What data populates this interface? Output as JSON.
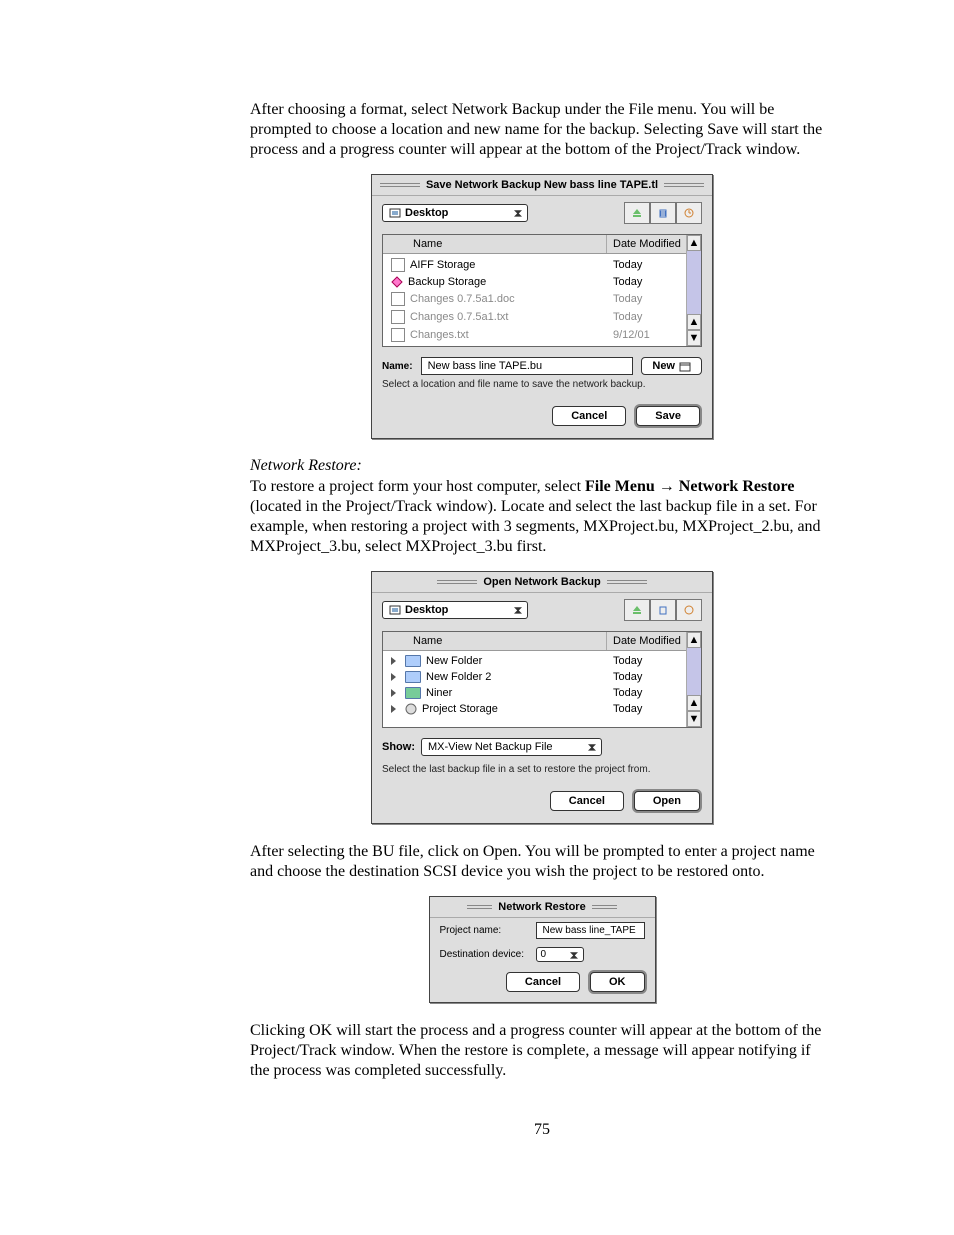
{
  "page_number": "75",
  "para1": "After choosing a format, select Network Backup under the File menu. You will be prompted to choose a location and new name for the backup.  Selecting Save will start the process and a progress counter will appear at the bottom of the Project/Track window.",
  "dialog_save": {
    "title": "Save Network Backup New bass line TAPE.tl",
    "location_dropdown": "Desktop",
    "columns": {
      "name": "Name",
      "date": "Date Modified"
    },
    "rows": [
      {
        "name": "AIFF Storage",
        "date": "Today",
        "icon": "drive",
        "disabled": false
      },
      {
        "name": "Backup Storage",
        "date": "Today",
        "icon": "diamond",
        "disabled": false
      },
      {
        "name": "Changes 0.7.5a1.doc",
        "date": "Today",
        "icon": "file",
        "disabled": true
      },
      {
        "name": "Changes 0.7.5a1.txt",
        "date": "Today",
        "icon": "file",
        "disabled": true
      },
      {
        "name": "Changes.txt",
        "date": "9/12/01",
        "icon": "file",
        "disabled": true
      }
    ],
    "name_label": "Name:",
    "name_value": "New bass line TAPE.bu",
    "new_button": "New",
    "hint": "Select a location and file name to save the network backup.",
    "cancel": "Cancel",
    "save": "Save"
  },
  "heading_restore": "Network Restore:",
  "para2_pre": "To restore a project form your host computer, select ",
  "para2_bold1": "File Menu",
  "para2_arrow": " → ",
  "para2_bold2": "Network Restore",
  "para2_post": " (located in the Project/Track window). Locate and select the last backup file in a set. For example, when restoring a project with 3 segments, MXProject.bu, MXProject_2.bu, and MXProject_3.bu, select MXProject_3.bu first.",
  "dialog_open": {
    "title": "Open Network Backup",
    "location_dropdown": "Desktop",
    "columns": {
      "name": "Name",
      "date": "Date Modified"
    },
    "rows": [
      {
        "name": "New Folder",
        "date": "Today"
      },
      {
        "name": "New Folder 2",
        "date": "Today"
      },
      {
        "name": "Niner",
        "date": "Today"
      },
      {
        "name": "Project Storage",
        "date": "Today"
      }
    ],
    "show_label": "Show:",
    "show_value": "MX-View Net Backup File",
    "hint": "Select the last backup file in a set to restore the project from.",
    "cancel": "Cancel",
    "open": "Open"
  },
  "para3": "After selecting the BU file, click on Open. You will be prompted to enter a project name and choose the destination SCSI device you wish the project to be restored onto.",
  "dialog_restore": {
    "title": "Network Restore",
    "project_label": "Project name:",
    "project_value": "New bass line_TAPE",
    "dest_label": "Destination device:",
    "dest_value": "0",
    "cancel": "Cancel",
    "ok": "OK"
  },
  "para4": "Clicking OK will start the process and a progress counter will appear at the bottom of the Project/Track window. When the restore is complete, a message will appear notifying if the process was completed successfully."
}
